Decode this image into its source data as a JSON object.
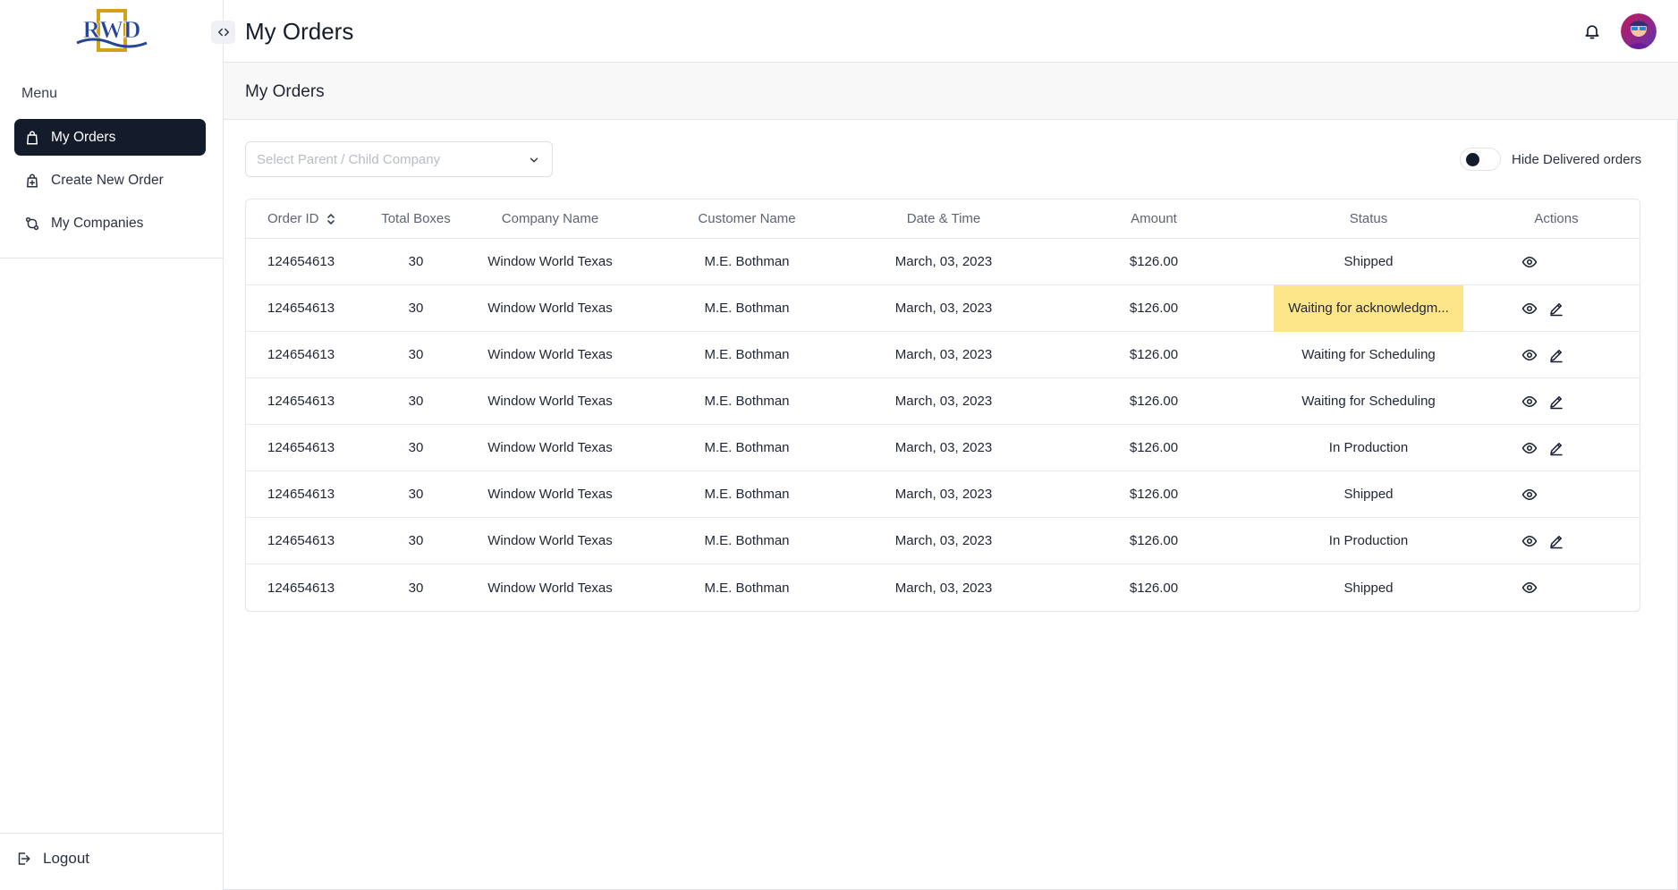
{
  "brand": {
    "logo_text": "RWD"
  },
  "sidebar": {
    "menu_heading": "Menu",
    "items": [
      {
        "label": "My Orders",
        "icon": "shopping-bag-icon",
        "active": true
      },
      {
        "label": "Create New Order",
        "icon": "bag-plus-icon",
        "active": false
      },
      {
        "label": "My Companies",
        "icon": "companies-icon",
        "active": false
      }
    ],
    "logout_label": "Logout"
  },
  "header": {
    "title": "My Orders"
  },
  "section": {
    "title": "My Orders"
  },
  "filters": {
    "company_select_placeholder": "Select Parent / Child Company",
    "hide_delivered_label": "Hide Delivered orders",
    "hide_delivered_on": false
  },
  "table": {
    "columns": [
      "Order ID",
      "Total Boxes",
      "Company Name",
      "Customer Name",
      "Date & Time",
      "Amount",
      "Status",
      "Actions"
    ],
    "rows": [
      {
        "order_id": "124654613",
        "boxes": "30",
        "company": "Window World Texas",
        "customer": "M.E. Bothman",
        "date": "March, 03, 2023",
        "amount": "$126.00",
        "status": "Shipped",
        "editable": false,
        "highlight": false
      },
      {
        "order_id": "124654613",
        "boxes": "30",
        "company": "Window World Texas",
        "customer": "M.E. Bothman",
        "date": "March, 03, 2023",
        "amount": "$126.00",
        "status": "Waiting for acknowledgm...",
        "editable": true,
        "highlight": true
      },
      {
        "order_id": "124654613",
        "boxes": "30",
        "company": "Window World Texas",
        "customer": "M.E. Bothman",
        "date": "March, 03, 2023",
        "amount": "$126.00",
        "status": "Waiting for Scheduling",
        "editable": true,
        "highlight": false
      },
      {
        "order_id": "124654613",
        "boxes": "30",
        "company": "Window World Texas",
        "customer": "M.E. Bothman",
        "date": "March, 03, 2023",
        "amount": "$126.00",
        "status": "Waiting for Scheduling",
        "editable": true,
        "highlight": false
      },
      {
        "order_id": "124654613",
        "boxes": "30",
        "company": "Window World Texas",
        "customer": "M.E. Bothman",
        "date": "March, 03, 2023",
        "amount": "$126.00",
        "status": "In Production",
        "editable": true,
        "highlight": false
      },
      {
        "order_id": "124654613",
        "boxes": "30",
        "company": "Window World Texas",
        "customer": "M.E. Bothman",
        "date": "March, 03, 2023",
        "amount": "$126.00",
        "status": "Shipped",
        "editable": false,
        "highlight": false
      },
      {
        "order_id": "124654613",
        "boxes": "30",
        "company": "Window World Texas",
        "customer": "M.E. Bothman",
        "date": "March, 03, 2023",
        "amount": "$126.00",
        "status": "In Production",
        "editable": true,
        "highlight": false
      },
      {
        "order_id": "124654613",
        "boxes": "30",
        "company": "Window World Texas",
        "customer": "M.E. Bothman",
        "date": "March, 03, 2023",
        "amount": "$126.00",
        "status": "Shipped",
        "editable": false,
        "highlight": false
      }
    ]
  },
  "colors": {
    "nav_active_bg": "#141b2b",
    "status_highlight": "#fde68a",
    "logo_gold": "#d4a017",
    "logo_blue": "#27459a"
  }
}
